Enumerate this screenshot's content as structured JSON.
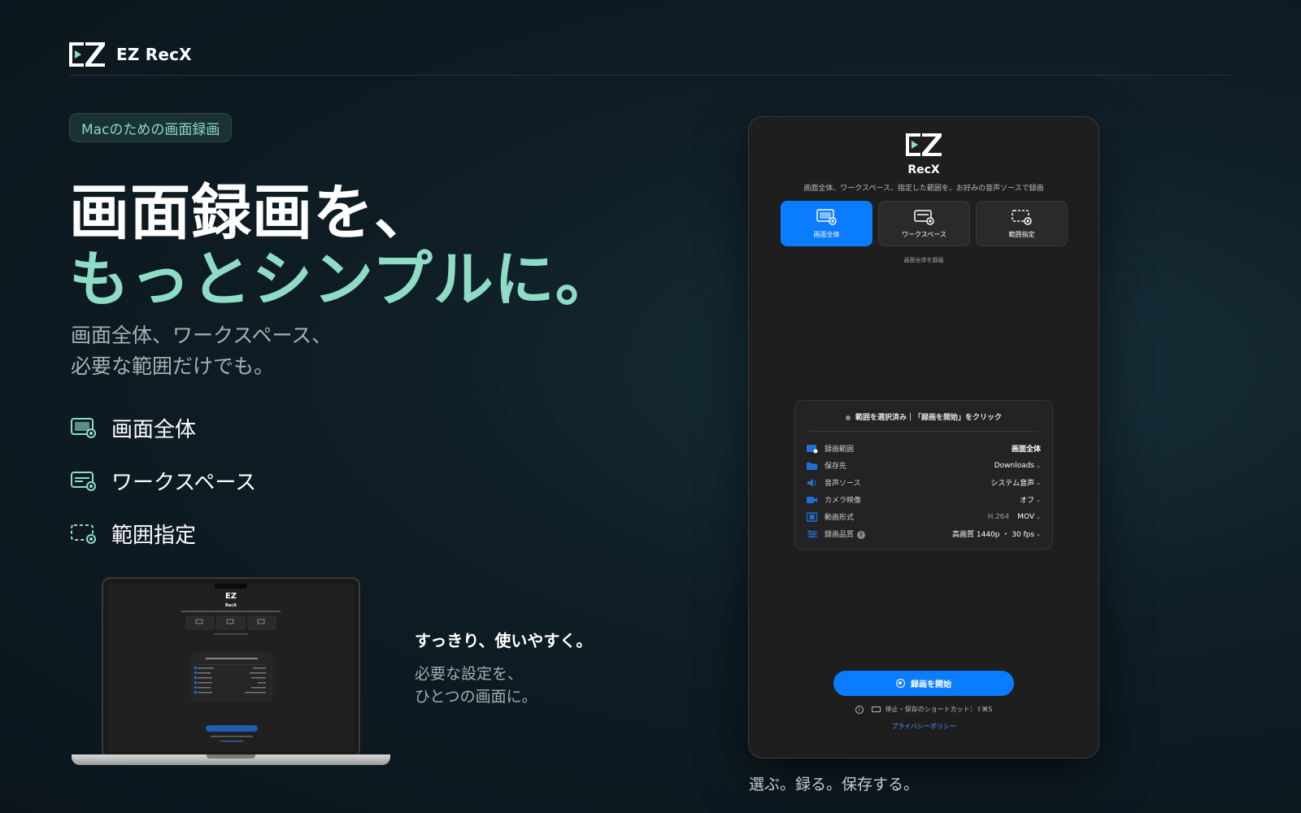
{
  "header": {
    "brand": "EZ RecX"
  },
  "tag": "Macのための画面録画",
  "hero": {
    "line1": "画面録画を、",
    "line2": "もっとシンプルに。"
  },
  "subtitle": {
    "line1": "画面全体、ワークスペース、",
    "line2": "必要な範囲だけでも。"
  },
  "features": [
    {
      "icon": "full-screen-icon",
      "label": "画面全体"
    },
    {
      "icon": "workspace-icon",
      "label": "ワークスペース"
    },
    {
      "icon": "region-icon",
      "label": "範囲指定"
    }
  ],
  "side_caption": {
    "title": "すっきり、使いやすく。",
    "line1": "必要な設定を、",
    "line2": "ひとつの画面に。"
  },
  "app": {
    "title": "RecX",
    "description": "画面全体、ワークスペース、指定した範囲を、お好みの音声ソースで録画",
    "modes": [
      {
        "label": "画面全体",
        "active": true
      },
      {
        "label": "ワークスペース",
        "active": false
      },
      {
        "label": "範囲指定",
        "active": false
      }
    ],
    "mode_caption": "画面全体を録画",
    "status": "範囲を選択済み｜「録画を開始」をクリック",
    "settings": [
      {
        "icon": "range-icon",
        "label": "録画範囲",
        "value": "画面全体"
      },
      {
        "icon": "folder-icon",
        "label": "保存先",
        "value": "Downloads",
        "dropdown": true
      },
      {
        "icon": "speaker-icon",
        "label": "音声ソース",
        "value": "システム音声",
        "dropdown": true
      },
      {
        "icon": "camera-icon",
        "label": "カメラ映像",
        "value": "オフ",
        "dropdown": true
      },
      {
        "icon": "film-icon",
        "label": "動画形式",
        "sub": "H.264",
        "value": "MOV",
        "dropdown": true
      },
      {
        "icon": "sliders-icon",
        "label": "録画品質",
        "value": "高画質 1440p ・ 30 fps",
        "dropdown": true,
        "help": "?"
      }
    ],
    "record_button": "録画を開始",
    "shortcut": "停止・保存のショートカット：⇧⌘S",
    "privacy": "プライバシーポリシー",
    "logo_text": "EZ"
  },
  "app_caption": "選ぶ。録る。保存する。",
  "colors": {
    "accent": "#8fdcc6",
    "blue": "#0a7cff",
    "bg": "#0f1d25"
  }
}
